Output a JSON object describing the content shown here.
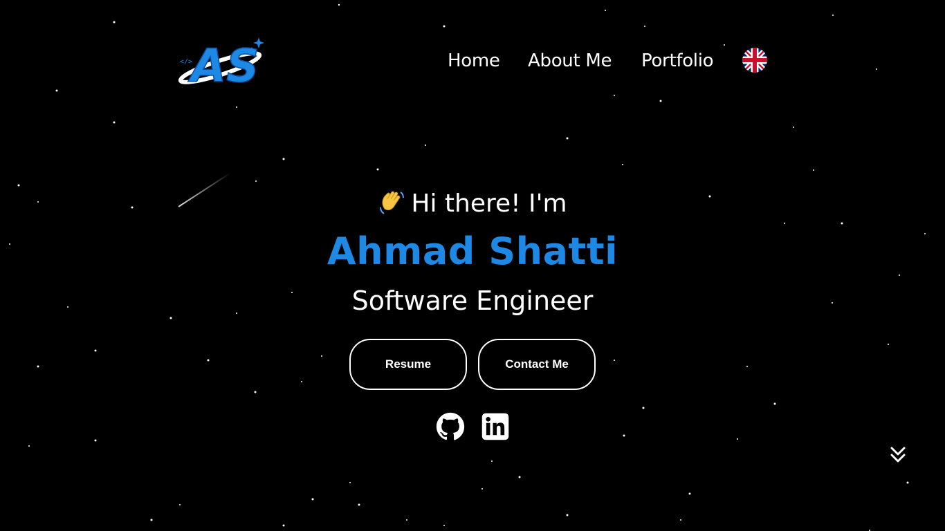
{
  "header": {
    "logo_text": "AS",
    "nav": [
      {
        "label": "Home"
      },
      {
        "label": "About Me"
      },
      {
        "label": "Portfolio"
      }
    ],
    "language_icon": "uk-flag-icon"
  },
  "hero": {
    "greeting_icon": "waving-hand-icon",
    "greeting": "Hi there! I'm",
    "name": "Ahmad Shatti",
    "role": "Software Engineer",
    "buttons": {
      "resume": "Resume",
      "contact": "Contact Me"
    },
    "social": [
      "github-icon",
      "linkedin-icon"
    ]
  },
  "scroll_icon": "chevron-double-down-icon",
  "colors": {
    "background": "#000000",
    "accent": "#1e88e5",
    "text": "#ffffff"
  }
}
